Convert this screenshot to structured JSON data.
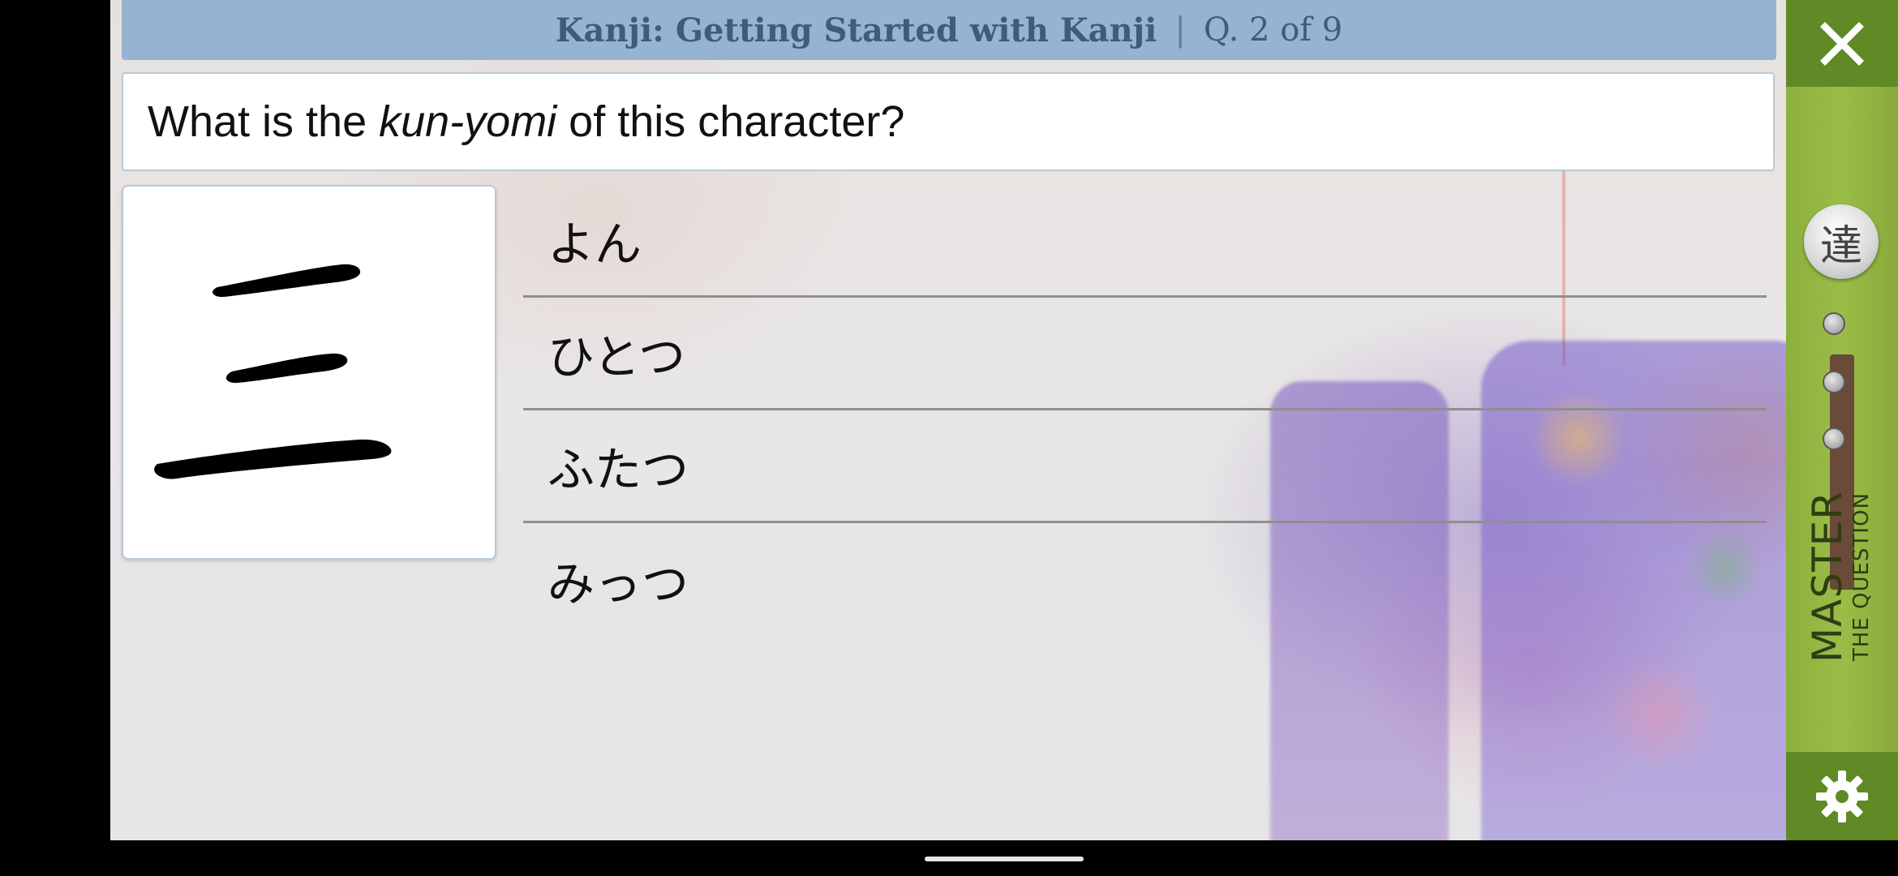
{
  "header": {
    "course": "Kanji: Getting Started with Kanji",
    "separator": "|",
    "progress": "Q. 2 of 9"
  },
  "question": {
    "prefix": "What is the ",
    "emphasis": "kun-yomi",
    "suffix": " of this character?"
  },
  "kanji": {
    "character": "三",
    "stroke_color": "#000000"
  },
  "answers": [
    {
      "label": "よん"
    },
    {
      "label": "ひとつ"
    },
    {
      "label": "ふたつ"
    },
    {
      "label": "みっつ"
    }
  ],
  "sidebar": {
    "close_icon": "close-icon",
    "master_knob_char": "達",
    "master_label": "MASTER",
    "master_sublabel": "THE QUESTION",
    "settings_icon": "gear-icon",
    "mastery_level": 0,
    "mastery_steps": 3
  },
  "colors": {
    "title_bar": "#94b4cf",
    "sidebar_green": "#86a93c",
    "sidebar_dark_green": "#5f8a25"
  }
}
